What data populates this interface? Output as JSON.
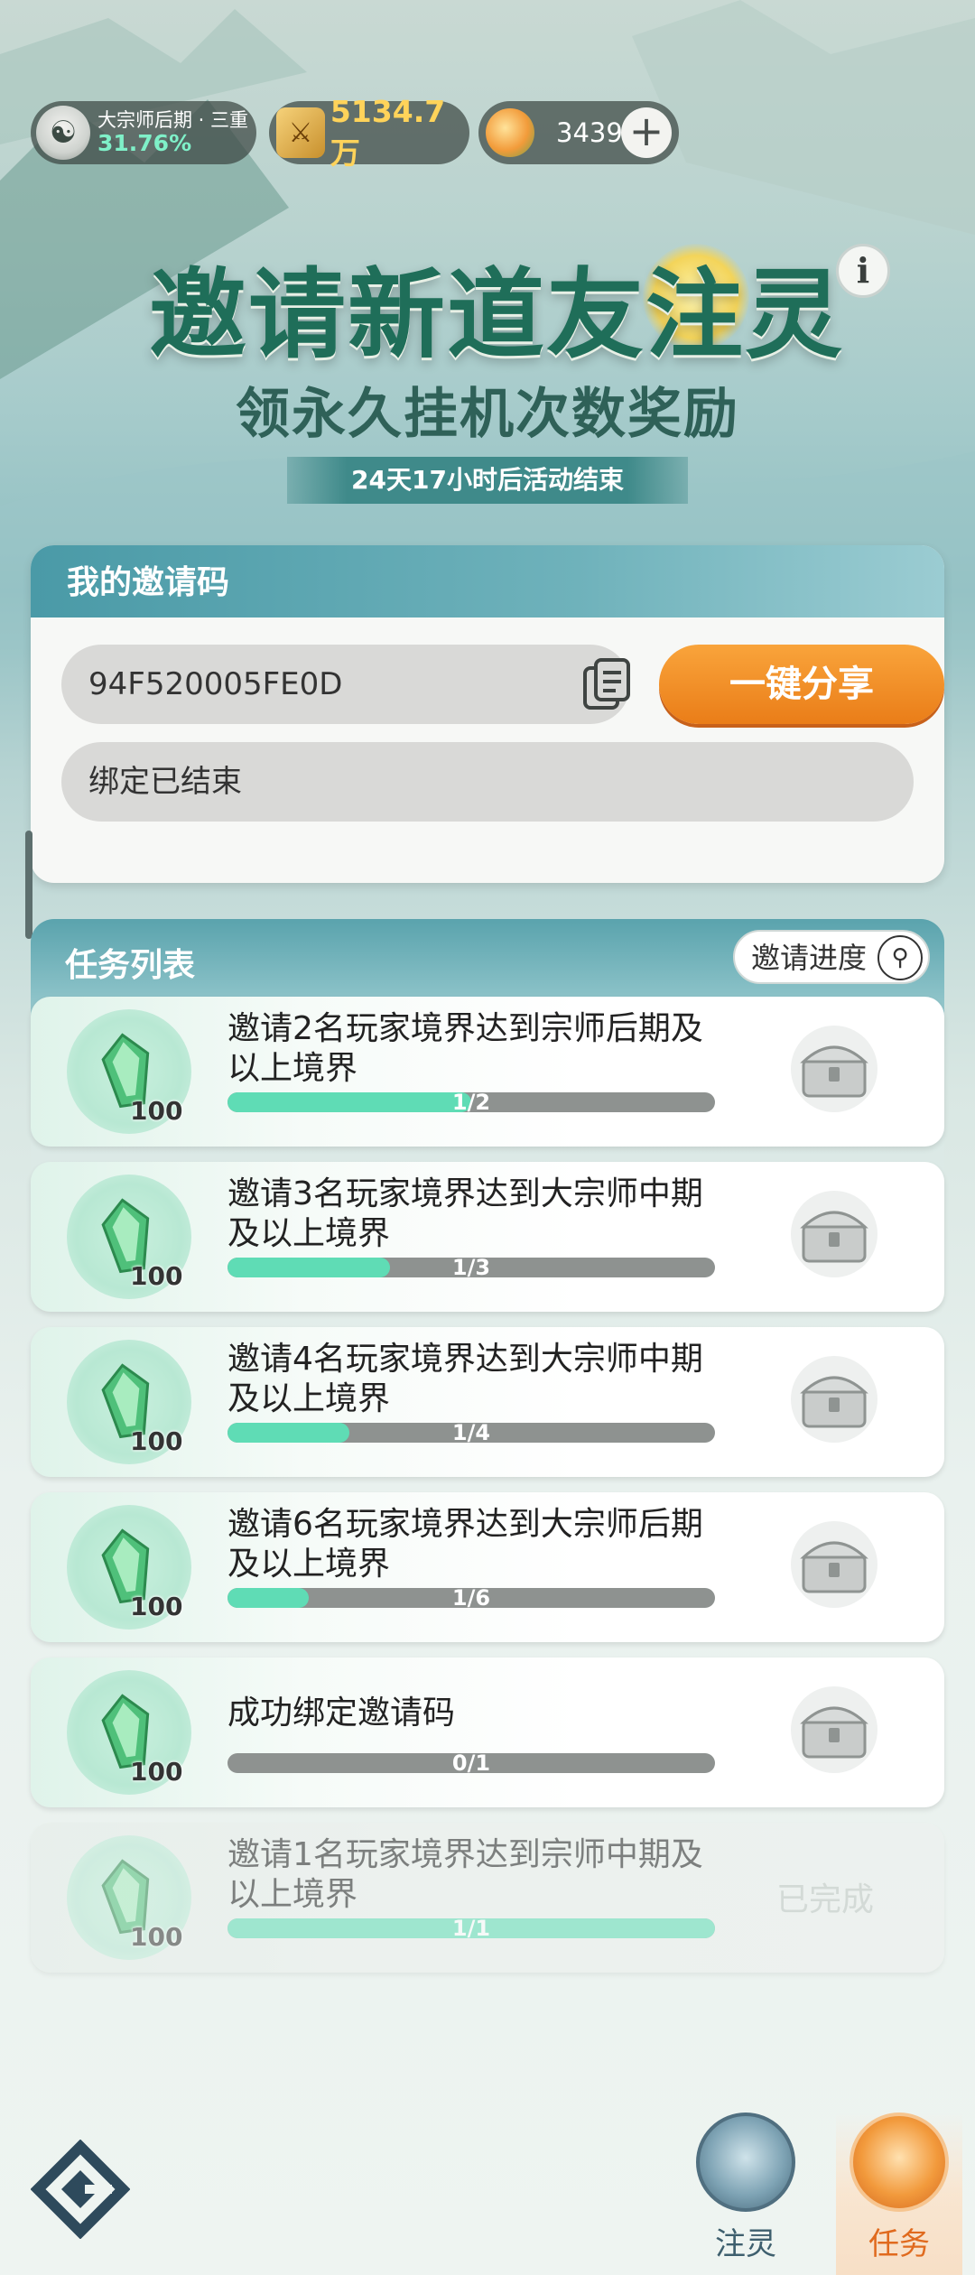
{
  "status_bar": {
    "rank_name": "大宗师后期 · 三重",
    "rank_progress": "31.76%",
    "power_value": "5134.7万",
    "jade_value": "3439",
    "plus_label": "+"
  },
  "event": {
    "title": "邀请新道友注灵",
    "info_label": "i",
    "subtitle": "领永久挂机次数奖励",
    "countdown": "24天17小时后活动结束"
  },
  "invite_code": {
    "header": "我的邀请码",
    "code": "94F520005FE0D",
    "share_label": "一键分享",
    "bind_status": "绑定已结束"
  },
  "tasks": {
    "header": "任务列表",
    "progress_button": "邀请进度",
    "items": [
      {
        "title": "邀请2名玩家境界达到宗师后期及以上境界",
        "reward_qty": "100",
        "progress_text": "1/2",
        "progress": 0.5,
        "status": "locked"
      },
      {
        "title": "邀请3名玩家境界达到大宗师中期及以上境界",
        "reward_qty": "100",
        "progress_text": "1/3",
        "progress": 0.333,
        "status": "locked"
      },
      {
        "title": "邀请4名玩家境界达到大宗师中期及以上境界",
        "reward_qty": "100",
        "progress_text": "1/4",
        "progress": 0.25,
        "status": "locked"
      },
      {
        "title": "邀请6名玩家境界达到大宗师后期及以上境界",
        "reward_qty": "100",
        "progress_text": "1/6",
        "progress": 0.167,
        "status": "locked"
      },
      {
        "title": "成功绑定邀请码",
        "reward_qty": "100",
        "progress_text": "0/1",
        "progress": 0,
        "status": "locked"
      },
      {
        "title": "邀请1名玩家境界达到宗师中期及以上境界",
        "reward_qty": "100",
        "progress_text": "1/1",
        "progress": 1,
        "status": "已完成"
      }
    ]
  },
  "bottom_nav": {
    "spirit_label": "注灵",
    "task_label": "任务"
  },
  "colors": {
    "accent_orange": "#ea7d18",
    "progress_fill": "#5fdcb5",
    "header_teal": "#4a9aa7"
  }
}
